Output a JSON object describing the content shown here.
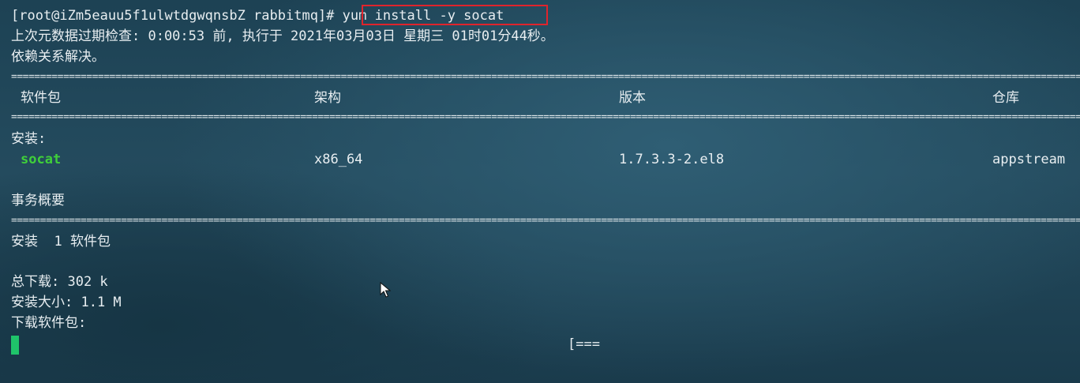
{
  "prompt": "[root@iZm5eauu5f1ulwtdgwqnsbZ rabbitmq]#",
  "command": "yum install -y socat",
  "metadata_line": "上次元数据过期检查: 0:00:53 前, 执行于 2021年03月03日 星期三 01时01分44秒。",
  "deps_resolved": "依赖关系解决。",
  "separator": "================================================================================================================================================================================================",
  "table": {
    "headers": [
      "软件包",
      "架构",
      "版本",
      "仓库"
    ],
    "section_install": "安装:",
    "rows": [
      {
        "package": "socat",
        "arch": "x86_64",
        "version": "1.7.3.3-2.el8",
        "repo": "appstream"
      }
    ]
  },
  "summary": {
    "title": "事务概要",
    "install_count": "安装  1 软件包",
    "total_download": "总下载: 302 k",
    "install_size": "安装大小: 1.1 M",
    "downloading": "下载软件包:",
    "progress": "[==="
  },
  "colors": {
    "highlight_box": "#e0242c",
    "package_name": "#3fcf3a",
    "cursor": "#1fc46a"
  }
}
